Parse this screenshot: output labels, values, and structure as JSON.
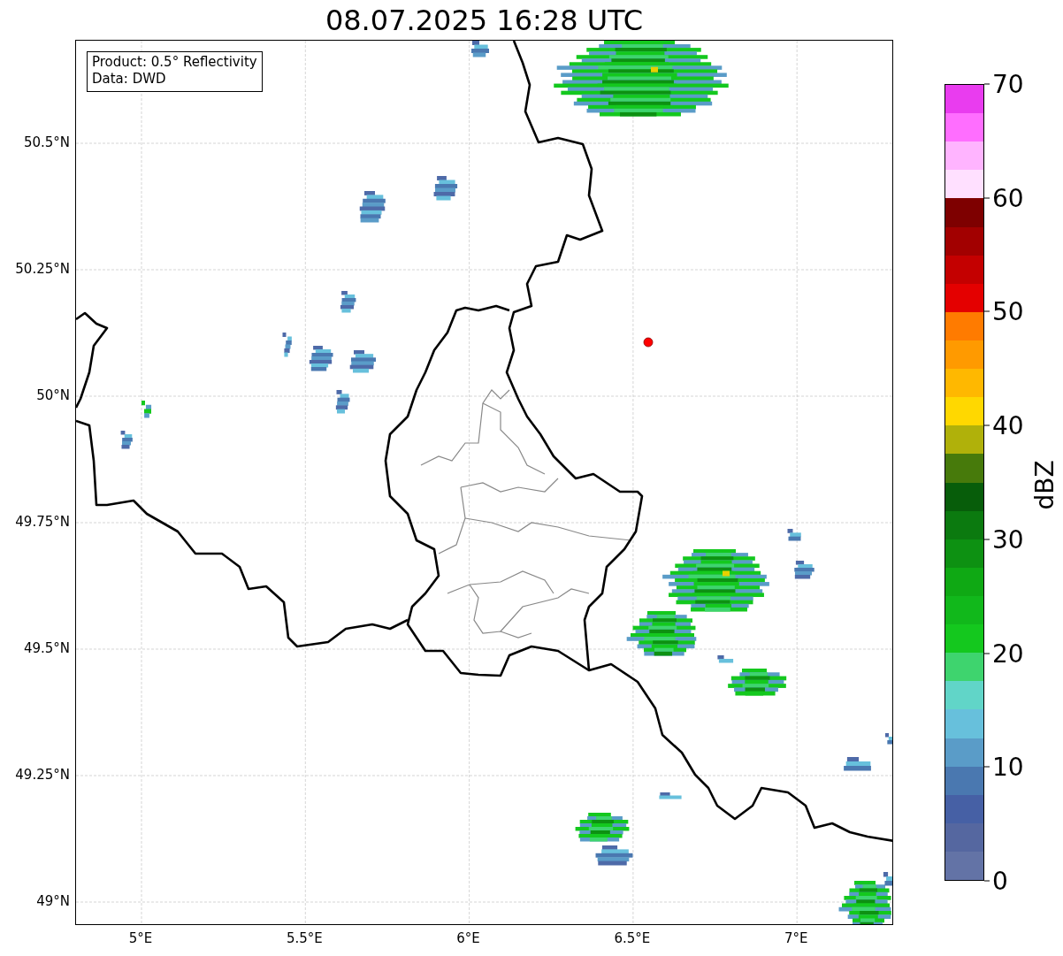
{
  "title": "08.07.2025 16:28 UTC",
  "map": {
    "info_lines": [
      "Product: 0.5° Reflectivity",
      "Data: DWD"
    ],
    "x_ticks": [
      "5°E",
      "5.5°E",
      "6°E",
      "6.5°E",
      "7°E"
    ],
    "y_ticks": [
      "50.5°N",
      "50.25°N",
      "50°N",
      "49.75°N",
      "49.5°N",
      "49.25°N",
      "49°N"
    ]
  },
  "colorbar": {
    "label": "dBZ",
    "ticks": [
      "70",
      "60",
      "50",
      "40",
      "30",
      "20",
      "10",
      "0"
    ],
    "bands": [
      {
        "color": "#e93cef"
      },
      {
        "color": "#ff6eff"
      },
      {
        "color": "#ffb4ff"
      },
      {
        "color": "#ffe0ff"
      },
      {
        "color": "#7e0000"
      },
      {
        "color": "#a20000"
      },
      {
        "color": "#c40000"
      },
      {
        "color": "#e40000"
      },
      {
        "color": "#ff7b00"
      },
      {
        "color": "#ff9a00"
      },
      {
        "color": "#ffb800"
      },
      {
        "color": "#ffd800"
      },
      {
        "color": "#b0b10a"
      },
      {
        "color": "#477a0b"
      },
      {
        "color": "#075d0a"
      },
      {
        "color": "#0b7a0f"
      },
      {
        "color": "#0d9112"
      },
      {
        "color": "#0fa914"
      },
      {
        "color": "#11b81b"
      },
      {
        "color": "#14c81e"
      },
      {
        "color": "#3ed46e"
      },
      {
        "color": "#61d5c8"
      },
      {
        "color": "#67c0dc"
      },
      {
        "color": "#5a9cc8"
      },
      {
        "color": "#4a78b0"
      },
      {
        "color": "#4660a5"
      },
      {
        "color": "#5567a0"
      },
      {
        "color": "#6373a6"
      }
    ]
  }
}
